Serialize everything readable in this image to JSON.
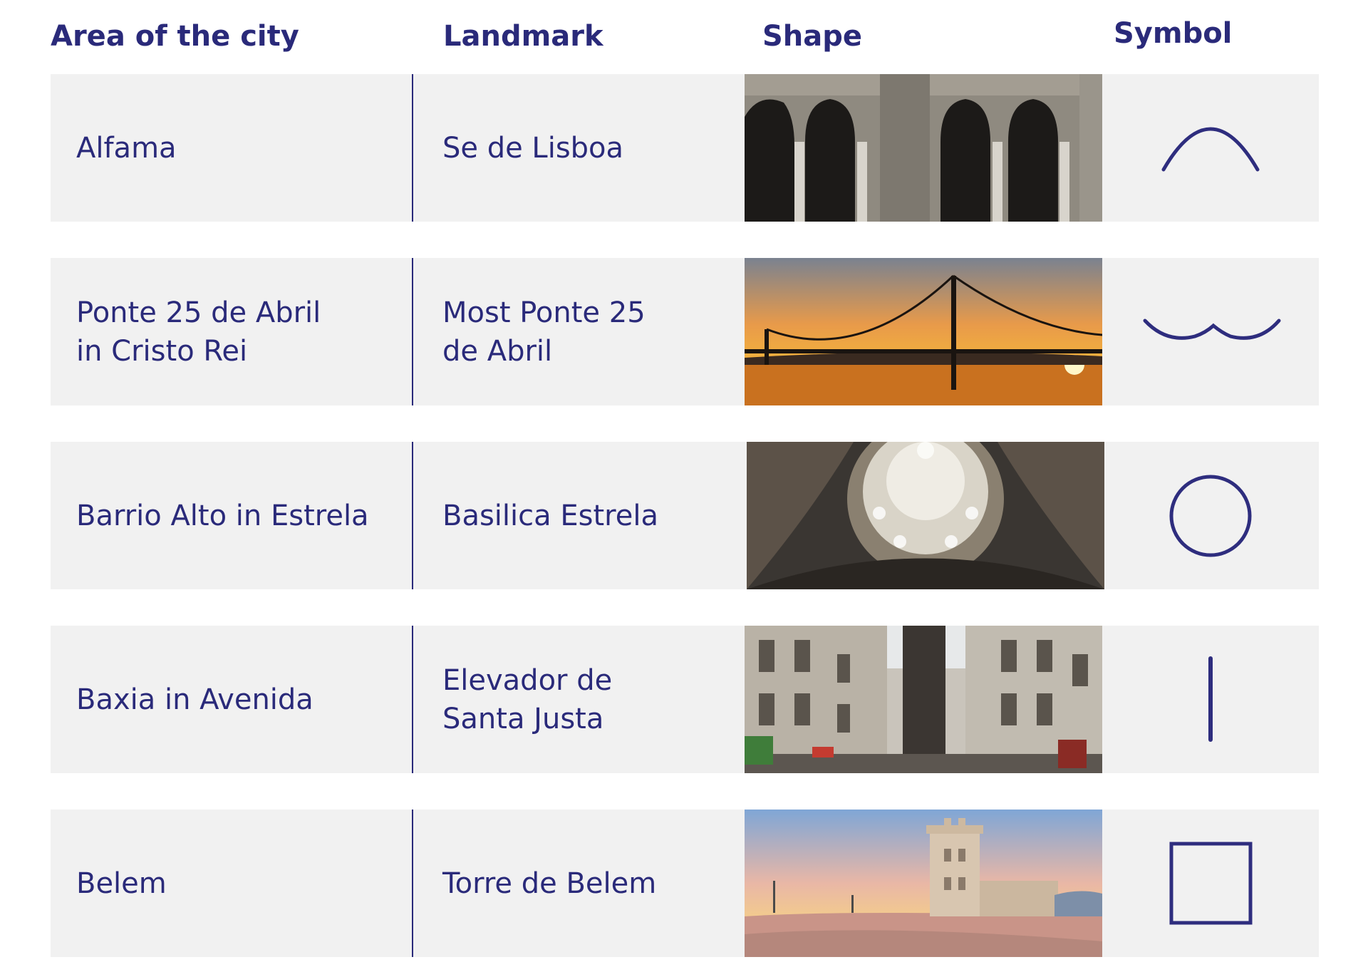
{
  "headers": {
    "area": "Area of the city",
    "landmark": "Landmark",
    "shape": "Shape",
    "symbol": "Symbol"
  },
  "rows": [
    {
      "area": "Alfama",
      "landmark": "Se de Lisboa",
      "image": "cathedral-arches-photo",
      "symbol": "arch-symbol-icon"
    },
    {
      "area": "Ponte 25 de Abril\nin Cristo Rei",
      "landmark": "Most Ponte 25\nde Abril",
      "image": "suspension-bridge-sunset-photo",
      "symbol": "wave-symbol-icon"
    },
    {
      "area": "Barrio Alto in Estrela",
      "landmark": "Basilica Estrela",
      "image": "basilica-dome-photo",
      "symbol": "circle-symbol-icon"
    },
    {
      "area": "Baxia in Avenida",
      "landmark": "Elevador de\nSanta Justa",
      "image": "elevator-street-photo",
      "symbol": "line-symbol-icon"
    },
    {
      "area": "Belem",
      "landmark": "Torre de Belem",
      "image": "belem-tower-photo",
      "symbol": "square-symbol-icon"
    }
  ],
  "colors": {
    "text": "#2a2a7a",
    "row_background": "#f1f1f1",
    "symbol_stroke": "#2e2d7e"
  }
}
